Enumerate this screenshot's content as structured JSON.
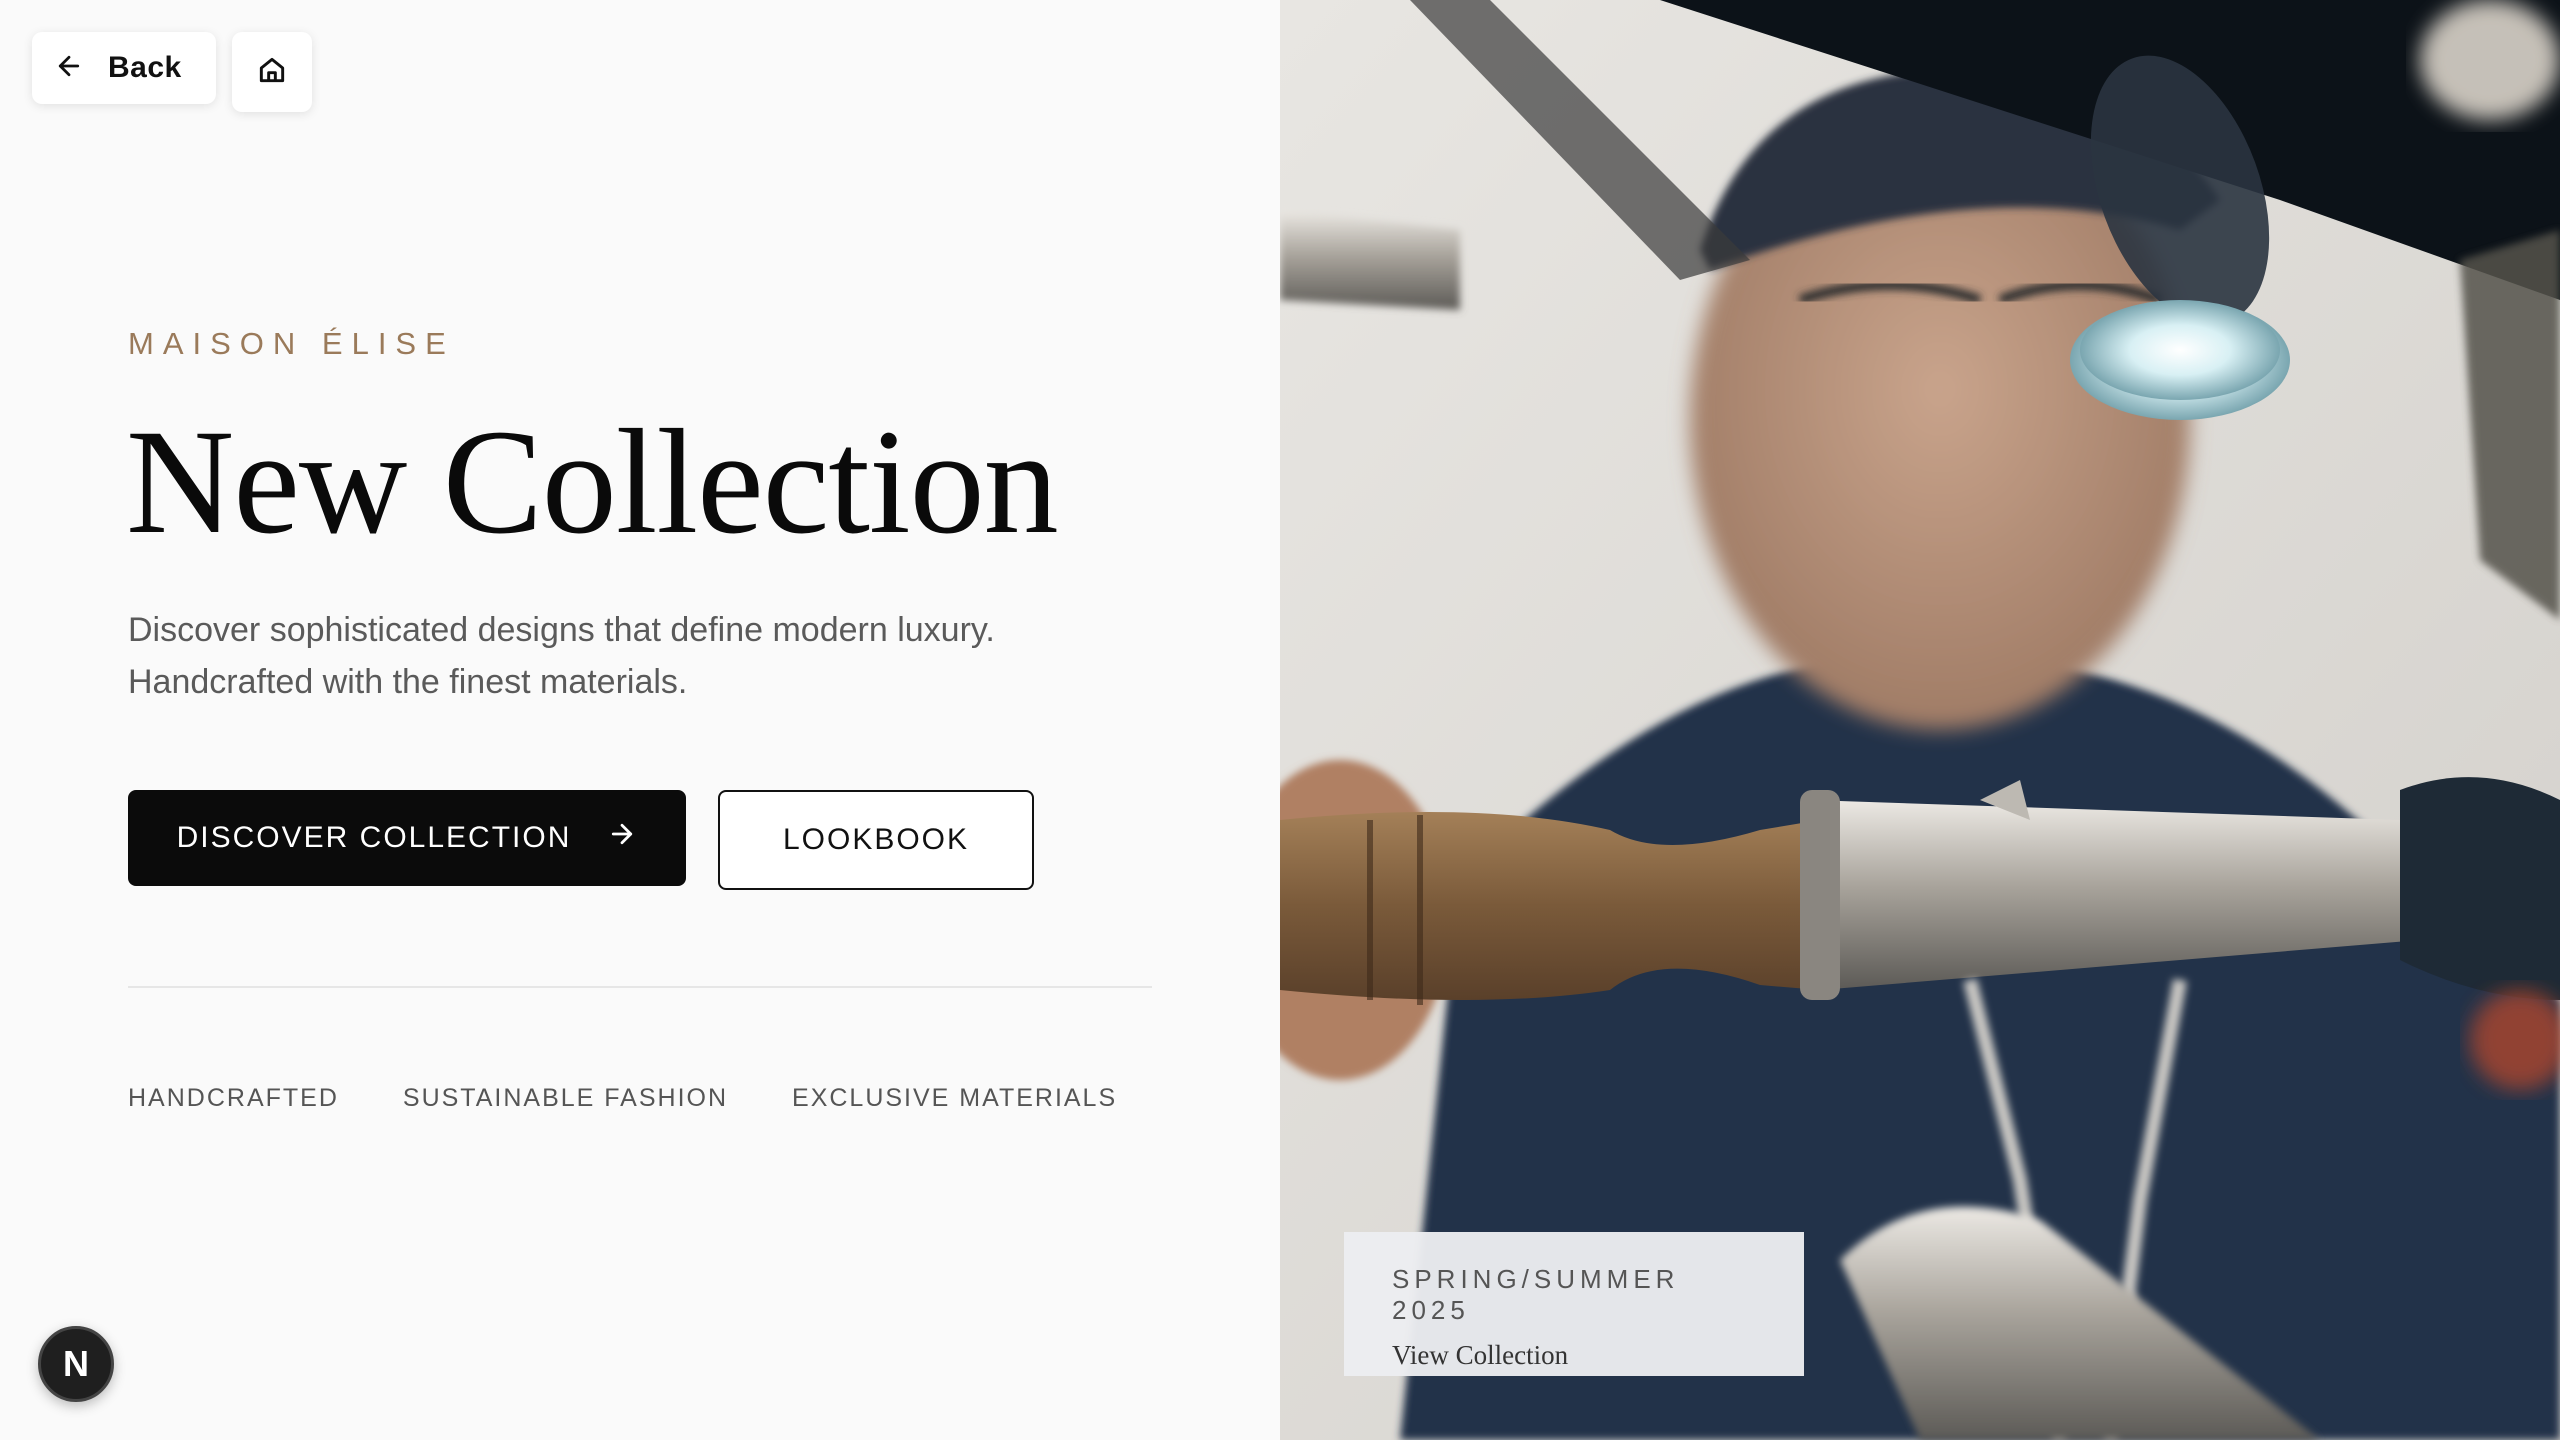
{
  "nav": {
    "back_label": "Back",
    "back_icon": "arrow-left-icon",
    "home_icon": "home-icon"
  },
  "hero": {
    "brand": "MAISON ÉLISE",
    "title": "New Collection",
    "description_line1": "Discover sophisticated designs that define modern luxury.",
    "description_line2": "Handcrafted with the finest materials.",
    "primary_button": "DISCOVER COLLECTION",
    "primary_icon": "arrow-right-icon",
    "secondary_button": "LOOKBOOK"
  },
  "features": [
    "HANDCRAFTED",
    "SUSTAINABLE FASHION",
    "EXCLUSIVE MATERIALS"
  ],
  "image_caption": {
    "season": "SPRING/SUMMER 2025",
    "link": "View Collection"
  },
  "badge": {
    "letter": "N"
  },
  "colors": {
    "accent": "#9a7a5a",
    "primary_button_bg": "#0b0b0b",
    "page_bg": "#fafafa"
  }
}
